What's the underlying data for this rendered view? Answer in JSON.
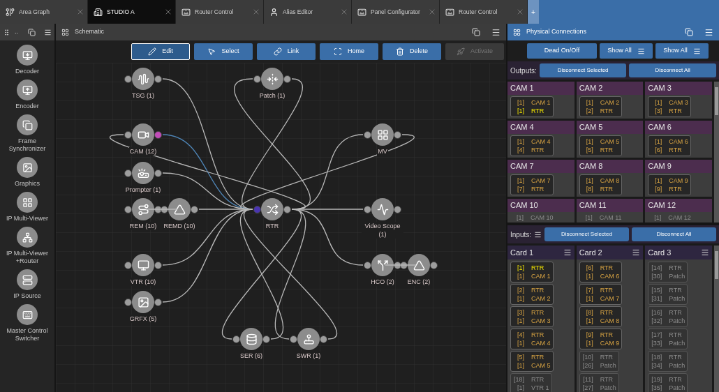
{
  "tabs": [
    {
      "label": "Area Graph",
      "kind": "graph",
      "selected": false
    },
    {
      "label": "STUDIO A",
      "kind": "studio",
      "selected": true
    },
    {
      "label": "Router Control",
      "kind": "panel",
      "selected": false
    },
    {
      "label": "Alias Editor",
      "kind": "person",
      "selected": false
    },
    {
      "label": "Panel Configurator",
      "kind": "panel",
      "selected": false
    },
    {
      "label": "Router Control",
      "kind": "panel",
      "selected": false
    }
  ],
  "new_tab": "+",
  "sidebar": {
    "dots": "..",
    "items": [
      {
        "label": "Decoder",
        "kind": "decoder"
      },
      {
        "label": "Encoder",
        "kind": "encoder"
      },
      {
        "label": "Frame Synchronizer",
        "kind": "framesync"
      },
      {
        "label": "Graphics",
        "kind": "graphics"
      },
      {
        "label": "IP Multi-Viewer",
        "kind": "multiviewer"
      },
      {
        "label": "IP Multi-Viewer +Router",
        "kind": "mvrouter"
      },
      {
        "label": "IP Source",
        "kind": "source"
      },
      {
        "label": "Master Control Switcher",
        "kind": "switcher"
      }
    ]
  },
  "schematic": {
    "title": "Schematic",
    "toolbar": [
      {
        "label": "Edit",
        "kind": "edit",
        "selected": true,
        "disabled": false
      },
      {
        "label": "Select",
        "kind": "select",
        "selected": false,
        "disabled": false
      },
      {
        "label": "Link",
        "kind": "link",
        "selected": false,
        "disabled": false
      },
      {
        "label": "Home",
        "kind": "home",
        "selected": false,
        "disabled": false
      },
      {
        "label": "Delete",
        "kind": "delete",
        "selected": false,
        "disabled": false
      },
      {
        "label": "Activate",
        "kind": "activate",
        "selected": false,
        "disabled": true
      }
    ],
    "nodes": [
      {
        "label": "TSG (1)",
        "kind": "tsg",
        "in_linked": false,
        "out_linked": false
      },
      {
        "label": "Patch (1)",
        "kind": "patch",
        "in_linked": false,
        "out_linked": false
      },
      {
        "label": "CAM (12)",
        "kind": "camera",
        "in_linked": false,
        "out_linked": true
      },
      {
        "label": "MV",
        "kind": "mv",
        "in_linked": false,
        "out_linked": false
      },
      {
        "label": "Prompter (1)",
        "kind": "prompter",
        "in_linked": false,
        "out_linked": false
      },
      {
        "label": "REM (10)",
        "kind": "rem",
        "in_linked": false,
        "out_linked": false
      },
      {
        "label": "REMD (10)",
        "kind": "remd",
        "in_linked": false,
        "out_linked": false
      },
      {
        "label": "RTR",
        "kind": "router",
        "in_linked": true,
        "out_linked": false
      },
      {
        "label": "Video Scope (1)",
        "kind": "scope",
        "in_linked": false,
        "out_linked": false
      },
      {
        "label": "VTR (10)",
        "kind": "vtr",
        "in_linked": false,
        "out_linked": false
      },
      {
        "label": "HCO (2)",
        "kind": "hco",
        "in_linked": false,
        "out_linked": false
      },
      {
        "label": "ENC (2)",
        "kind": "enc",
        "in_linked": false,
        "out_linked": false
      },
      {
        "label": "GRFX (5)",
        "kind": "grfx",
        "in_linked": false,
        "out_linked": false
      },
      {
        "label": "SER (6)",
        "kind": "server",
        "in_linked": false,
        "out_linked": false
      },
      {
        "label": "SWR (1)",
        "kind": "swr",
        "in_linked": false,
        "out_linked": false
      }
    ]
  },
  "connections": {
    "title": "Physical Connections",
    "toolbar": [
      {
        "label": "Dead On/Off",
        "menu": false
      },
      {
        "label": "Show All",
        "menu": true
      },
      {
        "label": "Show All",
        "menu": true
      }
    ],
    "outputs": {
      "label": "Outputs:",
      "buttons": [
        "Disconnect Selected",
        "Disconnect All"
      ],
      "cards": [
        {
          "title": "CAM 1",
          "active": true,
          "lines": [
            {
              "port": "[1]",
              "name": "CAM 1",
              "highlighted": false
            },
            {
              "port": "[1]",
              "name": "RTR",
              "highlighted": true
            }
          ]
        },
        {
          "title": "CAM 2",
          "active": true,
          "lines": [
            {
              "port": "[1]",
              "name": "CAM 2",
              "highlighted": false
            },
            {
              "port": "[2]",
              "name": "RTR",
              "highlighted": false
            }
          ]
        },
        {
          "title": "CAM 3",
          "active": true,
          "lines": [
            {
              "port": "[1]",
              "name": "CAM 3",
              "highlighted": false
            },
            {
              "port": "[3]",
              "name": "RTR",
              "highlighted": false
            }
          ]
        },
        {
          "title": "CAM 4",
          "active": true,
          "lines": [
            {
              "port": "[1]",
              "name": "CAM 4",
              "highlighted": false
            },
            {
              "port": "[4]",
              "name": "RTR",
              "highlighted": false
            }
          ]
        },
        {
          "title": "CAM 5",
          "active": true,
          "lines": [
            {
              "port": "[1]",
              "name": "CAM 5",
              "highlighted": false
            },
            {
              "port": "[5]",
              "name": "RTR",
              "highlighted": false
            }
          ]
        },
        {
          "title": "CAM 6",
          "active": true,
          "lines": [
            {
              "port": "[1]",
              "name": "CAM 6",
              "highlighted": false
            },
            {
              "port": "[6]",
              "name": "RTR",
              "highlighted": false
            }
          ]
        },
        {
          "title": "CAM 7",
          "active": true,
          "lines": [
            {
              "port": "[1]",
              "name": "CAM 7",
              "highlighted": false
            },
            {
              "port": "[7]",
              "name": "RTR",
              "highlighted": false
            }
          ]
        },
        {
          "title": "CAM 8",
          "active": true,
          "lines": [
            {
              "port": "[1]",
              "name": "CAM 8",
              "highlighted": false
            },
            {
              "port": "[8]",
              "name": "RTR",
              "highlighted": false
            }
          ]
        },
        {
          "title": "CAM 9",
          "active": true,
          "lines": [
            {
              "port": "[1]",
              "name": "CAM 9",
              "highlighted": false
            },
            {
              "port": "[9]",
              "name": "RTR",
              "highlighted": false
            }
          ]
        },
        {
          "title": "CAM 10",
          "active": false,
          "lines": [
            {
              "port": "[1]",
              "name": "CAM 10",
              "highlighted": false
            }
          ]
        },
        {
          "title": "CAM 11",
          "active": false,
          "lines": [
            {
              "port": "[1]",
              "name": "CAM 11",
              "highlighted": false
            }
          ]
        },
        {
          "title": "CAM 12",
          "active": false,
          "lines": [
            {
              "port": "[1]",
              "name": "CAM 12",
              "highlighted": false
            }
          ]
        }
      ]
    },
    "inputs": {
      "label": "Inputs:",
      "buttons": [
        "Disconnect Selected",
        "Disconnect All"
      ],
      "cards": [
        {
          "title": "Card 1",
          "entries": [
            {
              "active": true,
              "lines": [
                {
                  "port": "[1]",
                  "name": "RTR",
                  "highlighted": true
                },
                {
                  "port": "[1]",
                  "name": "CAM 1",
                  "highlighted": false
                }
              ]
            },
            {
              "active": true,
              "lines": [
                {
                  "port": "[2]",
                  "name": "RTR",
                  "highlighted": false
                },
                {
                  "port": "[1]",
                  "name": "CAM 2",
                  "highlighted": false
                }
              ]
            },
            {
              "active": true,
              "lines": [
                {
                  "port": "[3]",
                  "name": "RTR",
                  "highlighted": false
                },
                {
                  "port": "[1]",
                  "name": "CAM 3",
                  "highlighted": false
                }
              ]
            },
            {
              "active": true,
              "lines": [
                {
                  "port": "[4]",
                  "name": "RTR",
                  "highlighted": false
                },
                {
                  "port": "[1]",
                  "name": "CAM 4",
                  "highlighted": false
                }
              ]
            },
            {
              "active": true,
              "lines": [
                {
                  "port": "[5]",
                  "name": "RTR",
                  "highlighted": false
                },
                {
                  "port": "[1]",
                  "name": "CAM 5",
                  "highlighted": false
                }
              ]
            },
            {
              "active": false,
              "lines": [
                {
                  "port": "[18]",
                  "name": "RTR",
                  "highlighted": false
                },
                {
                  "port": "[1]",
                  "name": "VTR 1",
                  "highlighted": false
                }
              ]
            }
          ]
        },
        {
          "title": "Card 2",
          "entries": [
            {
              "active": true,
              "lines": [
                {
                  "port": "[6]",
                  "name": "RTR",
                  "highlighted": false
                },
                {
                  "port": "[1]",
                  "name": "CAM 6",
                  "highlighted": false
                }
              ]
            },
            {
              "active": true,
              "lines": [
                {
                  "port": "[7]",
                  "name": "RTR",
                  "highlighted": false
                },
                {
                  "port": "[1]",
                  "name": "CAM 7",
                  "highlighted": false
                }
              ]
            },
            {
              "active": true,
              "lines": [
                {
                  "port": "[8]",
                  "name": "RTR",
                  "highlighted": false
                },
                {
                  "port": "[1]",
                  "name": "CAM 8",
                  "highlighted": false
                }
              ]
            },
            {
              "active": true,
              "lines": [
                {
                  "port": "[9]",
                  "name": "RTR",
                  "highlighted": false
                },
                {
                  "port": "[1]",
                  "name": "CAM 9",
                  "highlighted": false
                }
              ]
            },
            {
              "active": false,
              "lines": [
                {
                  "port": "[10]",
                  "name": "RTR",
                  "highlighted": false
                },
                {
                  "port": "[26]",
                  "name": "Patch",
                  "highlighted": false
                }
              ]
            },
            {
              "active": false,
              "lines": [
                {
                  "port": "[11]",
                  "name": "RTR",
                  "highlighted": false
                },
                {
                  "port": "[27]",
                  "name": "Patch",
                  "highlighted": false
                }
              ]
            }
          ]
        },
        {
          "title": "Card 3",
          "entries": [
            {
              "active": false,
              "lines": [
                {
                  "port": "[14]",
                  "name": "RTR",
                  "highlighted": false
                },
                {
                  "port": "[30]",
                  "name": "Patch",
                  "highlighted": false
                }
              ]
            },
            {
              "active": false,
              "lines": [
                {
                  "port": "[15]",
                  "name": "RTR",
                  "highlighted": false
                },
                {
                  "port": "[31]",
                  "name": "Patch",
                  "highlighted": false
                }
              ]
            },
            {
              "active": false,
              "lines": [
                {
                  "port": "[16]",
                  "name": "RTR",
                  "highlighted": false
                },
                {
                  "port": "[32]",
                  "name": "Patch",
                  "highlighted": false
                }
              ]
            },
            {
              "active": false,
              "lines": [
                {
                  "port": "[17]",
                  "name": "RTR",
                  "highlighted": false
                },
                {
                  "port": "[33]",
                  "name": "Patch",
                  "highlighted": false
                }
              ]
            },
            {
              "active": false,
              "lines": [
                {
                  "port": "[18]",
                  "name": "RTR",
                  "highlighted": false
                },
                {
                  "port": "[34]",
                  "name": "Patch",
                  "highlighted": false
                }
              ]
            },
            {
              "active": false,
              "lines": [
                {
                  "port": "[19]",
                  "name": "RTR",
                  "highlighted": false
                },
                {
                  "port": "[35]",
                  "name": "Patch",
                  "highlighted": false
                }
              ]
            }
          ]
        }
      ]
    }
  }
}
